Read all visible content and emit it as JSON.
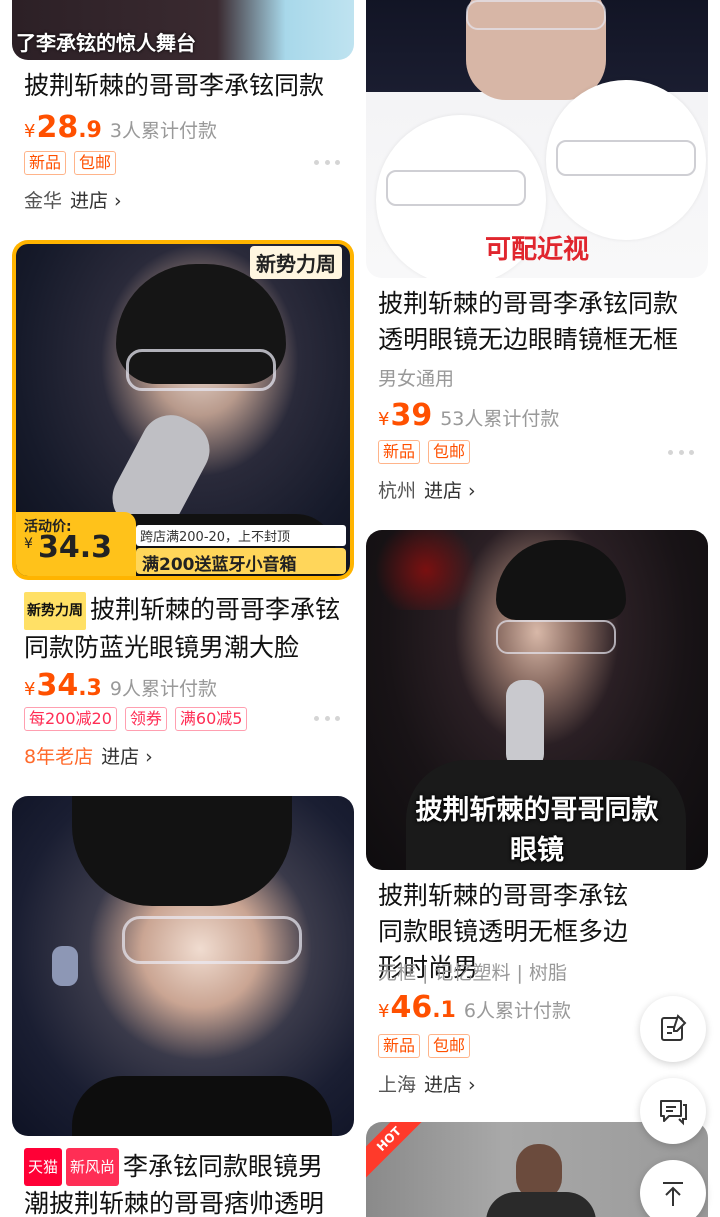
{
  "products": [
    {
      "title": "披荆斩棘的哥哥李承铉同款",
      "price_int": "28",
      "price_dec": ".9",
      "sold": "3人累计付款",
      "tags": [
        "新品",
        "包邮"
      ],
      "city": "金华",
      "enter": "进店 ›",
      "banner_text": "了李承铉的惊人舞台"
    },
    {
      "badge": "新势力周",
      "title": "披荆斩棘的哥哥李承铉同款防蓝光眼镜男潮大脸",
      "price_int": "34",
      "price_dec": ".3",
      "sold": "9人累计付款",
      "tags": [
        "每200减20",
        "领券",
        "满60减5"
      ],
      "shop_label": "8年老店",
      "enter": "进店 ›",
      "image_badge": "新势力周",
      "promo_label": "活动价:",
      "promo_price": "34.3",
      "promo_note": "跨店满200-20，上不封顶",
      "promo_gift": "满200送蓝牙小音箱"
    },
    {
      "badges": [
        "天猫",
        "新风尚"
      ],
      "title": "李承铉同款眼镜男潮披荆斩棘的哥哥痞帅透明"
    },
    {
      "title": "披荆斩棘的哥哥李承铉同款透明眼镜无边眼睛镜框无框",
      "subtitle": "男女通用",
      "price_int": "39",
      "price_dec": "",
      "sold": "53人累计付款",
      "tags": [
        "新品",
        "包邮"
      ],
      "city": "杭州",
      "enter": "进店 ›",
      "image_caption": "可配近视"
    },
    {
      "title": "披荆斩棘的哥哥李承铉同款眼镜透明无框多边形时尚男",
      "subtitle": "无框 | 记忆塑料 | 树脂",
      "price_int": "46",
      "price_dec": ".1",
      "sold": "6人累计付款",
      "tags": [
        "新品",
        "包邮"
      ],
      "city": "上海",
      "enter": "进店 ›",
      "image_caption_1": "披荆斩棘的哥哥同款",
      "image_caption_2": "眼镜"
    },
    {
      "corner_badge": "HOT"
    }
  ],
  "currency": "¥",
  "colors": {
    "accent": "#ff5000",
    "badge_red": "#ff2e55",
    "tmall_red": "#ff0036"
  }
}
